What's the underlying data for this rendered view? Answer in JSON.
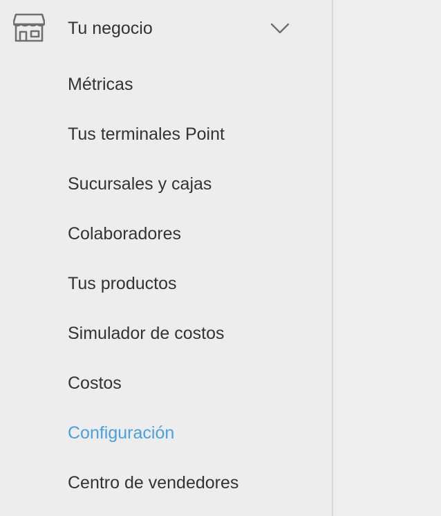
{
  "section": {
    "title": "Tu negocio",
    "icon": "store-icon",
    "expanded": true,
    "expand_icon": "chevron-down-icon"
  },
  "menu": {
    "items": [
      {
        "label": "Métricas",
        "active": false
      },
      {
        "label": "Tus terminales Point",
        "active": false
      },
      {
        "label": "Sucursales y cajas",
        "active": false
      },
      {
        "label": "Colaboradores",
        "active": false
      },
      {
        "label": "Tus productos",
        "active": false
      },
      {
        "label": "Simulador de costos",
        "active": false
      },
      {
        "label": "Costos",
        "active": false
      },
      {
        "label": "Configuración",
        "active": true
      },
      {
        "label": "Centro de vendedores",
        "active": false
      }
    ]
  },
  "colors": {
    "text": "#333333",
    "active": "#4aa0e0",
    "background": "#ededed",
    "divider": "#d7d7d7"
  }
}
